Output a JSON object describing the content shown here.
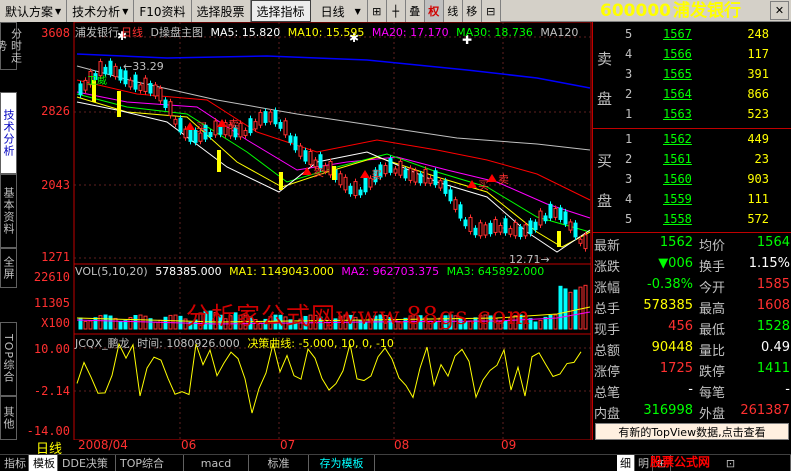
{
  "toolbar": {
    "items": [
      {
        "label": "默认方案",
        "arrow": "▼"
      },
      {
        "label": "技术分析",
        "arrow": "▼"
      },
      {
        "label": "F10资料"
      },
      {
        "label": "选择股票"
      },
      {
        "label": "选择指标"
      },
      {
        "label": "日线",
        "arrow": "▼"
      }
    ],
    "small_buttons": [
      "⊞",
      "┼",
      "叠",
      "权",
      "线",
      "移",
      "⊟"
    ],
    "close": "✕"
  },
  "stock": {
    "code": "600000",
    "name": "浦发银行"
  },
  "left_tabs": [
    "分时走势",
    "技术分析",
    "基本资料",
    "全屏",
    "TOP综合",
    "其他"
  ],
  "main_chart": {
    "header_name": "浦发银行",
    "header_period": "日线",
    "header_tpl": "D操盘主图",
    "ma": [
      {
        "label": "MA5: 15.820",
        "color": "#ffffff"
      },
      {
        "label": "MA10: 15.595",
        "color": "#ffff00"
      },
      {
        "label": "MA20: 17.170",
        "color": "#ff00ff"
      },
      {
        "label": "MA30: 18.736",
        "color": "#00ff00"
      },
      {
        "label": "MA120",
        "color": "#c0c0c0"
      }
    ],
    "y_ticks": [
      "3608",
      "2826",
      "2043",
      "1271"
    ],
    "hi_label": "33.29",
    "lo_label": "12.71",
    "signals": [
      "买",
      "卖",
      "买",
      "买",
      "卖",
      "卖"
    ],
    "weishou_label": "卫威"
  },
  "volume": {
    "header": "VOL(5,10,20)",
    "vol": "578385.000",
    "ma1": "MA1: 1149043.000",
    "ma2": "MA2: 962703.375",
    "ma3": "MA3: 645892.000",
    "y_ticks": [
      "22610",
      "11305",
      "X100"
    ]
  },
  "indicator": {
    "name": "JCQX_鹏龙",
    "time_label": "时间: 1080926.000",
    "curve_label": "决策曲线: -5.000, 10, 0, -10",
    "y_ticks": [
      "10.00",
      "-2.14",
      "-14.00"
    ]
  },
  "dates": [
    "日线",
    "2008/04",
    "06",
    "07",
    "08",
    "09"
  ],
  "watermark": "分析家公式网www.88gs.com",
  "site_watermark": "股票公式网www.88gs.com",
  "orderbook": {
    "sell_label": [
      "卖",
      "盘"
    ],
    "buy_label": [
      "买",
      "盘"
    ],
    "sell": [
      {
        "lvl": "5",
        "price": "1567",
        "vol": "248"
      },
      {
        "lvl": "4",
        "price": "1566",
        "vol": "117"
      },
      {
        "lvl": "3",
        "price": "1565",
        "vol": "391"
      },
      {
        "lvl": "2",
        "price": "1564",
        "vol": "866"
      },
      {
        "lvl": "1",
        "price": "1563",
        "vol": "523"
      }
    ],
    "buy": [
      {
        "lvl": "1",
        "price": "1562",
        "vol": "449"
      },
      {
        "lvl": "2",
        "price": "1561",
        "vol": "23"
      },
      {
        "lvl": "3",
        "price": "1560",
        "vol": "903"
      },
      {
        "lvl": "4",
        "price": "1559",
        "vol": "111"
      },
      {
        "lvl": "5",
        "price": "1558",
        "vol": "572"
      }
    ]
  },
  "stats": [
    {
      "l1": "最新",
      "v1": "1562",
      "c1": "#00ff00",
      "l2": "均价",
      "v2": "1564",
      "c2": "#00ff00"
    },
    {
      "l1": "涨跌",
      "v1": "▼006",
      "c1": "#00ff00",
      "l2": "换手",
      "v2": "1.15%",
      "c2": "#ffffff"
    },
    {
      "l1": "涨幅",
      "v1": "-0.38%",
      "c1": "#00ff00",
      "l2": "今开",
      "v2": "1585",
      "c2": "#ff3030"
    },
    {
      "l1": "总手",
      "v1": "578385",
      "c1": "#ffff00",
      "l2": "最高",
      "v2": "1608",
      "c2": "#ff3030"
    },
    {
      "l1": "现手",
      "v1": "456",
      "c1": "#ff3030",
      "l2": "最低",
      "v2": "1528",
      "c2": "#00ff00"
    },
    {
      "l1": "总额",
      "v1": "90448",
      "c1": "#ffff00",
      "l2": "量比",
      "v2": "0.49",
      "c2": "#ffffff"
    },
    {
      "l1": "涨停",
      "v1": "1725",
      "c1": "#ff3030",
      "l2": "跌停",
      "v2": "1411",
      "c2": "#00ff00"
    },
    {
      "l1": "总笔",
      "v1": "-",
      "c1": "#ffffff",
      "l2": "每笔",
      "v2": "-",
      "c2": "#ffffff"
    },
    {
      "l1": "内盘",
      "v1": "316998",
      "c1": "#00ff00",
      "l2": "外盘",
      "v2": "261387",
      "c2": "#ff3030"
    }
  ],
  "topview_button": "有新的TopView数据,点击查看",
  "bottom_tabs": [
    "指标",
    "模板",
    "DDE决策",
    "TOP综合",
    "macd",
    "标准",
    "存为模板"
  ],
  "bottom_right": [
    "细",
    "明",
    "⊞",
    "⊡"
  ],
  "colors": {
    "up": "#ff3030",
    "down": "#00ffff",
    "accent": "#ffff00",
    "border": "#c00000"
  }
}
